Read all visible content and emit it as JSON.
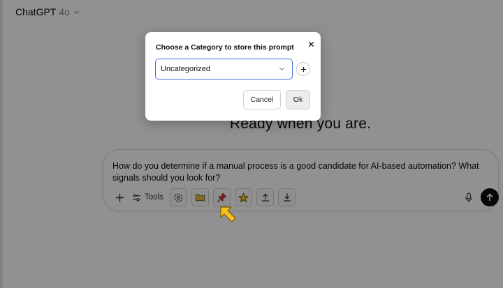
{
  "header": {
    "model_name": "ChatGPT",
    "model_version": "4o"
  },
  "main": {
    "heading": "Ready when you are."
  },
  "composer": {
    "prompt_text": "How do you determine if a manual process is a good candidate for AI-based automation? What signals should you look for?",
    "tools_label": "Tools",
    "extension_icons": [
      "settings-icon",
      "folder-icon",
      "pin-icon",
      "star-icon",
      "export-icon",
      "import-icon"
    ]
  },
  "dialog": {
    "title": "Choose a Category to store this prompt",
    "selected_category": "Uncategorized",
    "cancel_label": "Cancel",
    "ok_label": "Ok"
  },
  "colors": {
    "select_border": "#3b6fd6",
    "pin_accent": "#d9413a",
    "star_accent": "#f4c21b",
    "folder_accent": "#e9b949",
    "pointer": "#f7c21a"
  }
}
